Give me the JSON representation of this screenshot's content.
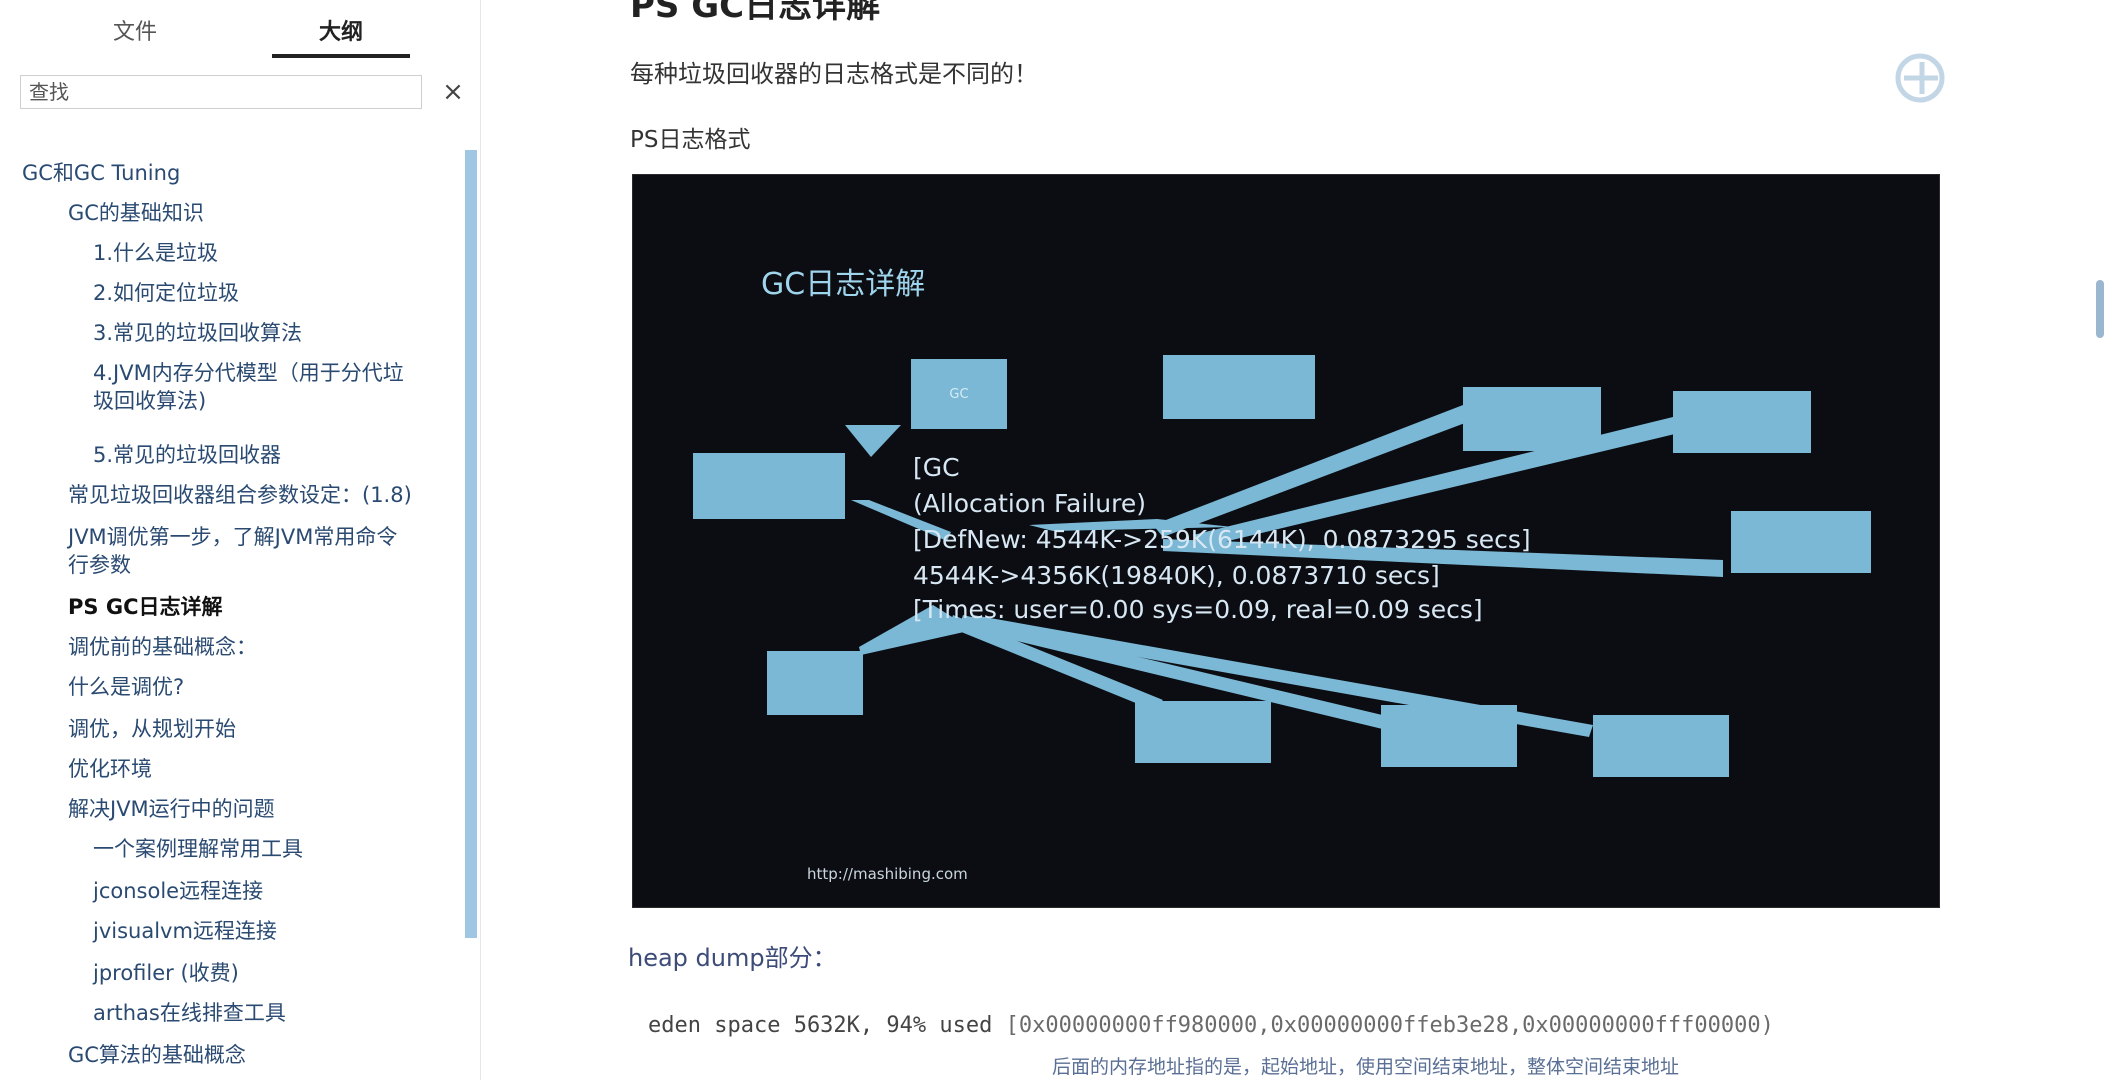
{
  "sidebar": {
    "tabs": {
      "files": "文件",
      "outline": "大纲"
    },
    "search_placeholder": "查找",
    "clear_icon": "×",
    "items": [
      "GC和GC Tuning",
      "GC的基础知识",
      "1.什么是垃圾",
      "2.如何定位垃圾",
      "3.常见的垃圾回收算法",
      "4.JVM内存分代模型（用于分代垃",
      "圾回收算法)",
      "5.常见的垃圾回收器",
      "常见垃圾回收器组合参数设定：(1.8)",
      "JVM调优第一步，了解JVM常用命令",
      "行参数",
      "PS GC日志详解",
      "调优前的基础概念：",
      "什么是调优?",
      "调优，从规划开始",
      "优化环境",
      "解决JVM运行中的问题",
      "一个案例理解常用工具",
      "jconsole远程连接",
      "jvisualvm远程连接",
      "jprofiler (收费)",
      "arthas在线排查工具",
      "GC算法的基础概念"
    ]
  },
  "main": {
    "heading": "PS GC日志详解",
    "intro": "每种垃圾回收器的日志格式是不同的！",
    "ps_format_label": "PS日志格式",
    "slide": {
      "title": "GC日志详解",
      "lines": [
        "[GC",
        " (Allocation Failure)",
        "[DefNew: 4544K->259K(6144K), 0.0873295 secs]",
        "4544K->4356K(19840K), 0.0873710 secs]",
        "[Times: user=0.00 sys=0.09, real=0.09 secs]"
      ],
      "url": "http://mashibing.com",
      "callouts": [
        "GC",
        "",
        "",
        "",
        "",
        "",
        "",
        "",
        "",
        "",
        ""
      ]
    },
    "heap_dump_label": "heap dump部分：",
    "eden_prefix": "eden space 5632K, 94% used ",
    "eden_addresses": "[0x00000000ff980000,0x00000000ffeb3e28,0x00000000fff00000)",
    "eden_note": "后面的内存地址指的是，起始地址，使用空间结束地址，整体空间结束地址"
  }
}
